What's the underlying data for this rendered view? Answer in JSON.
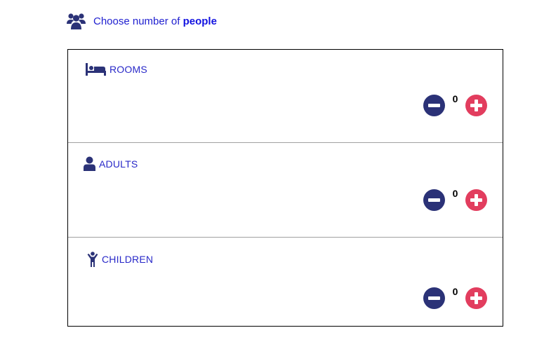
{
  "header": {
    "prefix": "Choose number of",
    "emphasis": "people",
    "icon": "group-users-icon"
  },
  "rows": [
    {
      "id": "rooms",
      "label": "ROOMS",
      "icon": "bed-icon",
      "count": "0"
    },
    {
      "id": "adults",
      "label": "ADULTS",
      "icon": "user-icon",
      "count": "0"
    },
    {
      "id": "children",
      "label": "CHILDREN",
      "icon": "child-icon",
      "count": "0"
    }
  ],
  "colors": {
    "label": "#2828c8",
    "minus_button": "#2b3277",
    "plus_button": "#e23d5e",
    "icon": "#2b3277"
  }
}
